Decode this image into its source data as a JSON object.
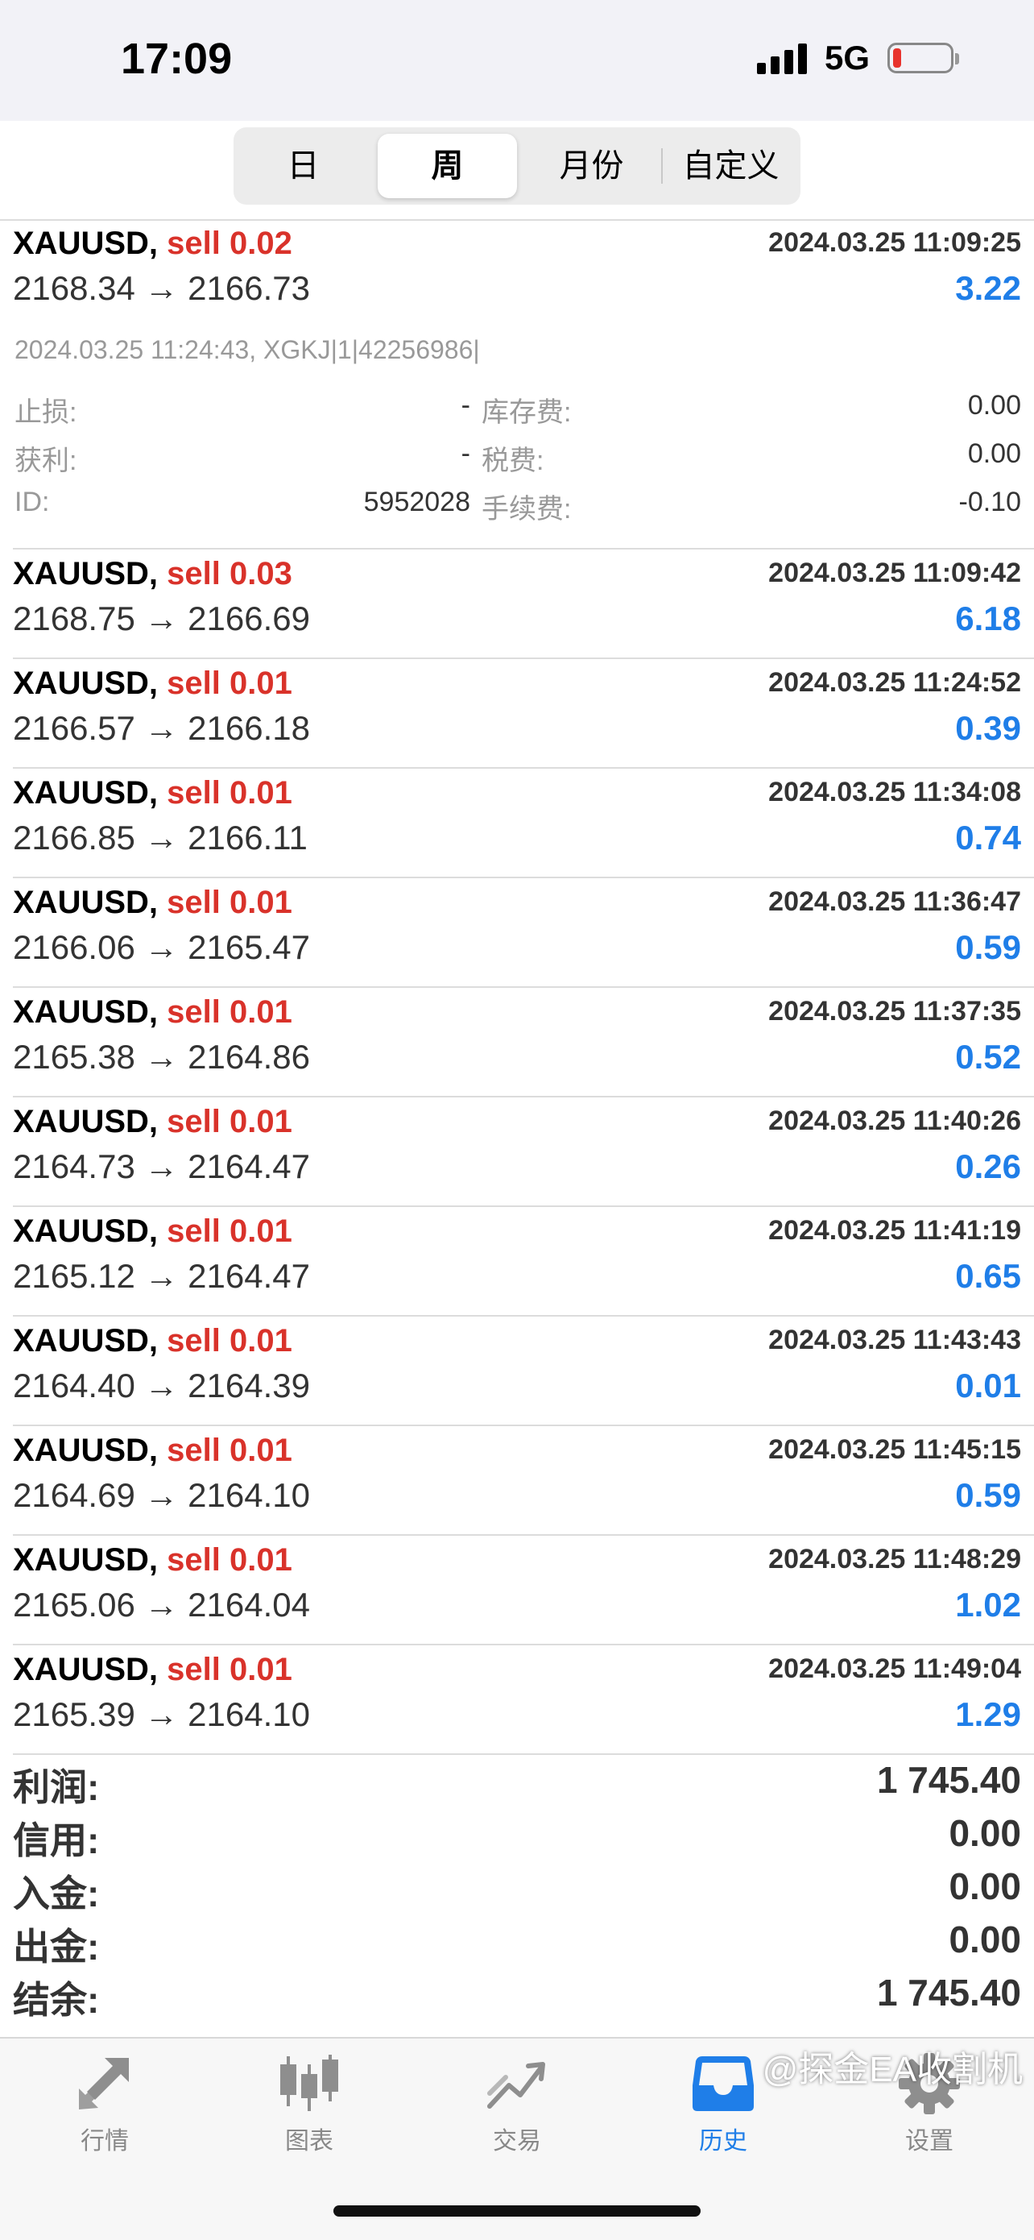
{
  "status_bar": {
    "time": "17:09",
    "network": "5G"
  },
  "period_tabs": [
    {
      "label": "日",
      "active": false
    },
    {
      "label": "周",
      "active": true
    },
    {
      "label": "月份",
      "active": false
    },
    {
      "label": "自定义",
      "active": false
    }
  ],
  "colors": {
    "sell": "#d9322a",
    "profit": "#1f7ee8",
    "active_tab": "#1f7ee8"
  },
  "expanded_trade": {
    "symbol": "XAUUSD,",
    "side": "sell 0.02",
    "datetime": "2024.03.25 11:09:25",
    "prices": "2168.34 → 2166.73",
    "profit": "3.22",
    "comment": "2024.03.25 11:24:43, XGKJ|1|42256986|",
    "details": {
      "stop_loss_label": "止损:",
      "stop_loss_value": "-",
      "swap_label": "库存费:",
      "swap_value": "0.00",
      "take_profit_label": "获利:",
      "take_profit_value": "-",
      "tax_label": "税费:",
      "tax_value": "0.00",
      "id_label": "ID:",
      "id_value": "5952028",
      "commission_label": "手续费:",
      "commission_value": "-0.10"
    }
  },
  "trades": [
    {
      "symbol": "XAUUSD,",
      "side": "sell 0.03",
      "datetime": "2024.03.25 11:09:42",
      "prices": "2168.75 → 2166.69",
      "profit": "6.18"
    },
    {
      "symbol": "XAUUSD,",
      "side": "sell 0.01",
      "datetime": "2024.03.25 11:24:52",
      "prices": "2166.57 → 2166.18",
      "profit": "0.39"
    },
    {
      "symbol": "XAUUSD,",
      "side": "sell 0.01",
      "datetime": "2024.03.25 11:34:08",
      "prices": "2166.85 → 2166.11",
      "profit": "0.74"
    },
    {
      "symbol": "XAUUSD,",
      "side": "sell 0.01",
      "datetime": "2024.03.25 11:36:47",
      "prices": "2166.06 → 2165.47",
      "profit": "0.59"
    },
    {
      "symbol": "XAUUSD,",
      "side": "sell 0.01",
      "datetime": "2024.03.25 11:37:35",
      "prices": "2165.38 → 2164.86",
      "profit": "0.52"
    },
    {
      "symbol": "XAUUSD,",
      "side": "sell 0.01",
      "datetime": "2024.03.25 11:40:26",
      "prices": "2164.73 → 2164.47",
      "profit": "0.26"
    },
    {
      "symbol": "XAUUSD,",
      "side": "sell 0.01",
      "datetime": "2024.03.25 11:41:19",
      "prices": "2165.12 → 2164.47",
      "profit": "0.65"
    },
    {
      "symbol": "XAUUSD,",
      "side": "sell 0.01",
      "datetime": "2024.03.25 11:43:43",
      "prices": "2164.40 → 2164.39",
      "profit": "0.01"
    },
    {
      "symbol": "XAUUSD,",
      "side": "sell 0.01",
      "datetime": "2024.03.25 11:45:15",
      "prices": "2164.69 → 2164.10",
      "profit": "0.59"
    },
    {
      "symbol": "XAUUSD,",
      "side": "sell 0.01",
      "datetime": "2024.03.25 11:48:29",
      "prices": "2165.06 → 2164.04",
      "profit": "1.02"
    },
    {
      "symbol": "XAUUSD,",
      "side": "sell 0.01",
      "datetime": "2024.03.25 11:49:04",
      "prices": "2165.39 → 2164.10",
      "profit": "1.29"
    }
  ],
  "totals": [
    {
      "label": "利润:",
      "value": "1 745.40"
    },
    {
      "label": "信用:",
      "value": "0.00"
    },
    {
      "label": "入金:",
      "value": "0.00"
    },
    {
      "label": "出金:",
      "value": "0.00"
    },
    {
      "label": "结余:",
      "value": "1 745.40"
    }
  ],
  "bottom_tabs": [
    {
      "label": "行情",
      "icon": "arrows-icon",
      "active": false
    },
    {
      "label": "图表",
      "icon": "candlestick-icon",
      "active": false
    },
    {
      "label": "交易",
      "icon": "trend-icon",
      "active": false
    },
    {
      "label": "历史",
      "icon": "inbox-icon",
      "active": true
    },
    {
      "label": "设置",
      "icon": "gear-icon",
      "active": false
    }
  ],
  "watermark": "@探金EA收割机"
}
